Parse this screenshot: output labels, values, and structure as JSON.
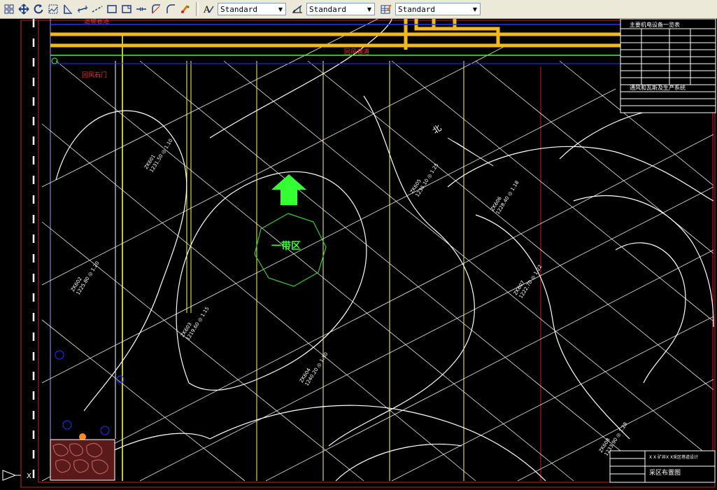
{
  "toolbar": {
    "icons": [
      "grid-icon",
      "pan-icon",
      "rotate-icon",
      "rectangle-select-icon",
      "angle-icon",
      "dimension-icon",
      "dimension-dash-icon",
      "frame-icon",
      "frame-corner-icon",
      "arrow-join-icon",
      "arc-tool-icon",
      "arc-line-icon",
      "paint-icon"
    ],
    "text_style": {
      "icon": "text-style-icon",
      "value": "Standard"
    },
    "dim_style": {
      "icon": "dim-style-icon",
      "value": "Standard"
    },
    "table_style": {
      "icon": "table-style-icon",
      "value": "Standard"
    }
  },
  "drawing": {
    "zone_label": "一带区",
    "north_label": "北",
    "legend_table_title": "主要机电设备一览表",
    "legend_table_subtitle": "通风和瓦斯及生产系统",
    "title_block_label": "采区布置图",
    "title_block_project": "X X 矿井X X采区巷道设计",
    "red_label_left": "回风石门",
    "red_label_top": "运输巷道",
    "red_label_top2": "回风巷道",
    "borehole_labels": [
      {
        "id": "ZK601",
        "detail": "1231.50 ◎ 1.10"
      },
      {
        "id": "ZK602",
        "detail": "1225.80 ◎ 1.20"
      },
      {
        "id": "ZK603",
        "detail": "1219.60 ◎ 1.15"
      },
      {
        "id": "ZK604",
        "detail": "1240.20 ◎ 1.30"
      },
      {
        "id": "ZK605",
        "detail": "1236.10 ◎ 1.25"
      },
      {
        "id": "ZK606",
        "detail": "1228.40 ◎ 1.18"
      },
      {
        "id": "ZK607",
        "detail": "1222.70 ◎ 1.22"
      },
      {
        "id": "ZK608",
        "detail": "1233.90 ◎ 1.28"
      }
    ],
    "colors": {
      "background": "#000000",
      "tunnel": "#f2b81c",
      "accent_green": "#33ff33",
      "contour": "#ffffff",
      "frame_red": "#cc2222",
      "blue": "#2233ff",
      "yellow_line": "#ffff66"
    }
  }
}
